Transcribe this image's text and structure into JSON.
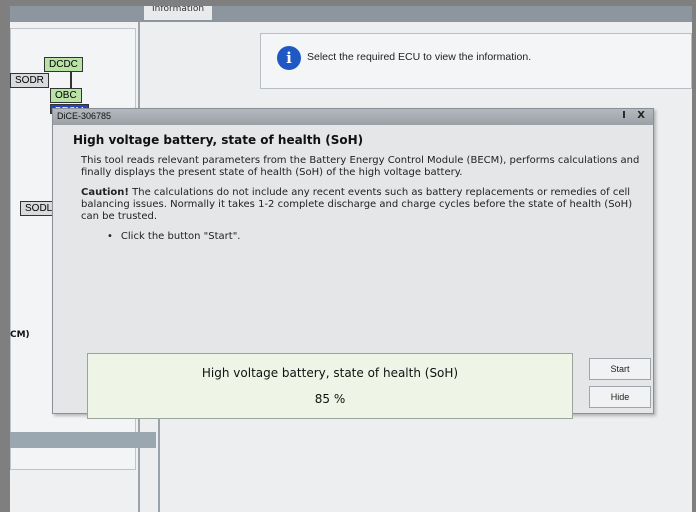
{
  "background": {
    "tab_label": "Information",
    "info_message": "Select the required ECU to view the information.",
    "ecu": {
      "dcdc": "DCDC",
      "obc": "OBC",
      "becm": "BECM",
      "sodr": "SODR",
      "sodl": "SODL",
      "partial_label": "CM)"
    }
  },
  "dialog": {
    "window_id": "DiCE-306785",
    "controls": [
      "I",
      "X"
    ],
    "heading": "High voltage battery, state of health (SoH)",
    "intro": "This tool reads relevant parameters from the Battery Energy Control Module (BECM), performs calculations and finally displays the present state of health (SoH) of the high voltage battery.",
    "caution_label": "Caution!",
    "caution_text": "The calculations do not include any recent events such as battery replacements or remedies of cell balancing issues. Normally it takes 1-2 complete discharge and charge cycles before the state of health (SoH) can be trusted.",
    "instruction": "Click the button \"Start\".",
    "result": {
      "title": "High voltage battery, state of health (SoH)",
      "value": "85 %"
    },
    "buttons": {
      "start": "Start",
      "hide": "Hide"
    }
  },
  "colors": {
    "ecu_green": "#b9e2a6",
    "ecu_blue": "#1f46c8",
    "info_icon": "#1f57c3",
    "result_bg": "#eef5e6"
  }
}
